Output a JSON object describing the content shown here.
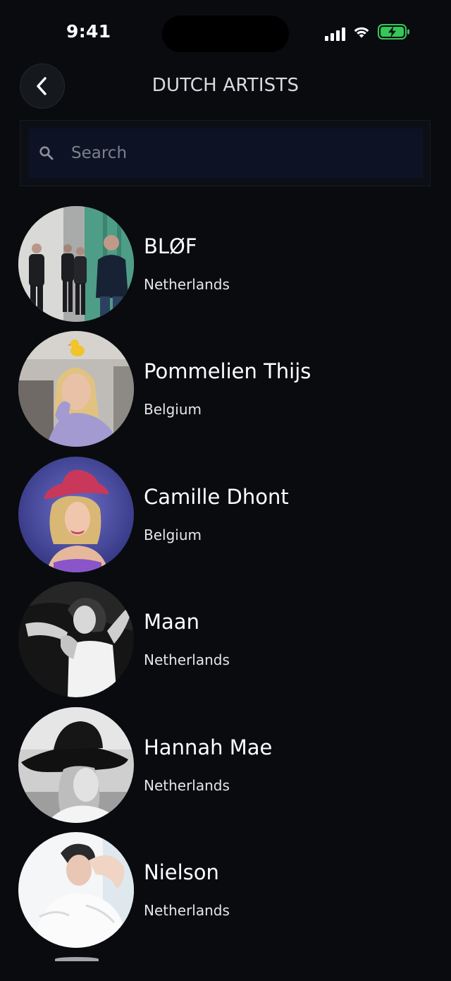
{
  "status_bar": {
    "time": "9:41",
    "icons": [
      "cellular-signal-icon",
      "wifi-icon",
      "battery-charging-icon"
    ]
  },
  "header": {
    "title": "DUTCH ARTISTS",
    "back_icon": "chevron-left-icon"
  },
  "search": {
    "placeholder": "Search",
    "value": "",
    "icon": "search-icon"
  },
  "artists": [
    {
      "name": "BLØF",
      "country": "Netherlands"
    },
    {
      "name": "Pommelien Thijs",
      "country": "Belgium"
    },
    {
      "name": "Camille Dhont",
      "country": "Belgium"
    },
    {
      "name": "Maan",
      "country": "Netherlands"
    },
    {
      "name": "Hannah Mae",
      "country": "Netherlands"
    },
    {
      "name": "Nielson",
      "country": "Netherlands"
    }
  ],
  "colors": {
    "background": "#090b0f",
    "search_field": "#0d1324",
    "battery_fill": "#35c759",
    "text_primary": "#ffffff",
    "placeholder": "#7b808b"
  }
}
